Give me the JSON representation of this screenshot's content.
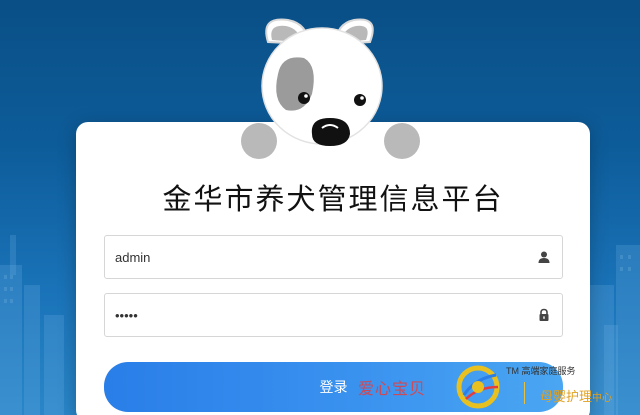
{
  "title": "金华市养犬管理信息平台",
  "username": {
    "value": "admin",
    "icon": "user-icon"
  },
  "password": {
    "value": "•••••",
    "icon": "lock-icon"
  },
  "login_label": "登录",
  "watermark": {
    "left_text": "爱心宝贝",
    "tm_text": "TM 高端家庭服务",
    "right_text": "母婴护理",
    "right_suffix": "中心"
  },
  "colors": {
    "background": "#0d5c9a",
    "button": "#3a92ef",
    "watermark_red": "#e63c3c",
    "watermark_gold": "#e0a020"
  }
}
